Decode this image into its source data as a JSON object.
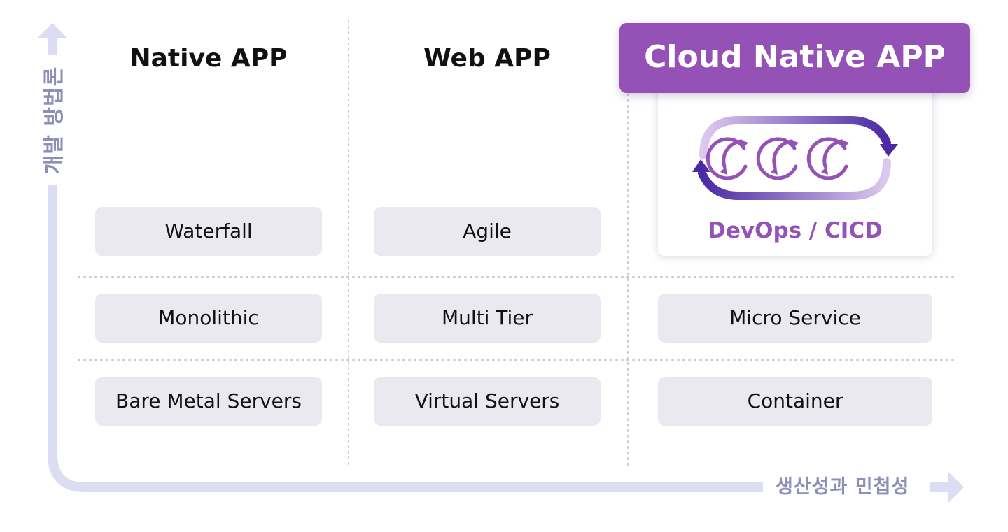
{
  "axis": {
    "y_label": "개발 방법론",
    "x_label": "생산성과 민첩성"
  },
  "columns": [
    {
      "title": "Native APP"
    },
    {
      "title": "Web APP"
    },
    {
      "title": "Cloud Native APP"
    }
  ],
  "rows": {
    "methodology": [
      "Waterfall",
      "Agile",
      "DevOps / CICD"
    ],
    "architecture": [
      "Monolithic",
      "Multi Tier",
      "Micro Service"
    ],
    "infrastructure": [
      "Bare Metal Servers",
      "Virtual Servers",
      "Container"
    ]
  },
  "icons": {
    "devops_cycle": "devops-cycle-icon",
    "y_arrow": "arrow-up-icon",
    "x_arrow": "arrow-right-icon"
  },
  "colors": {
    "accent": "#9552b6",
    "accent_dark": "#4b2aa3",
    "cell_bg": "#e9e9ef",
    "axis": "#dcdcf2",
    "axis_text": "#8e8eb6"
  }
}
